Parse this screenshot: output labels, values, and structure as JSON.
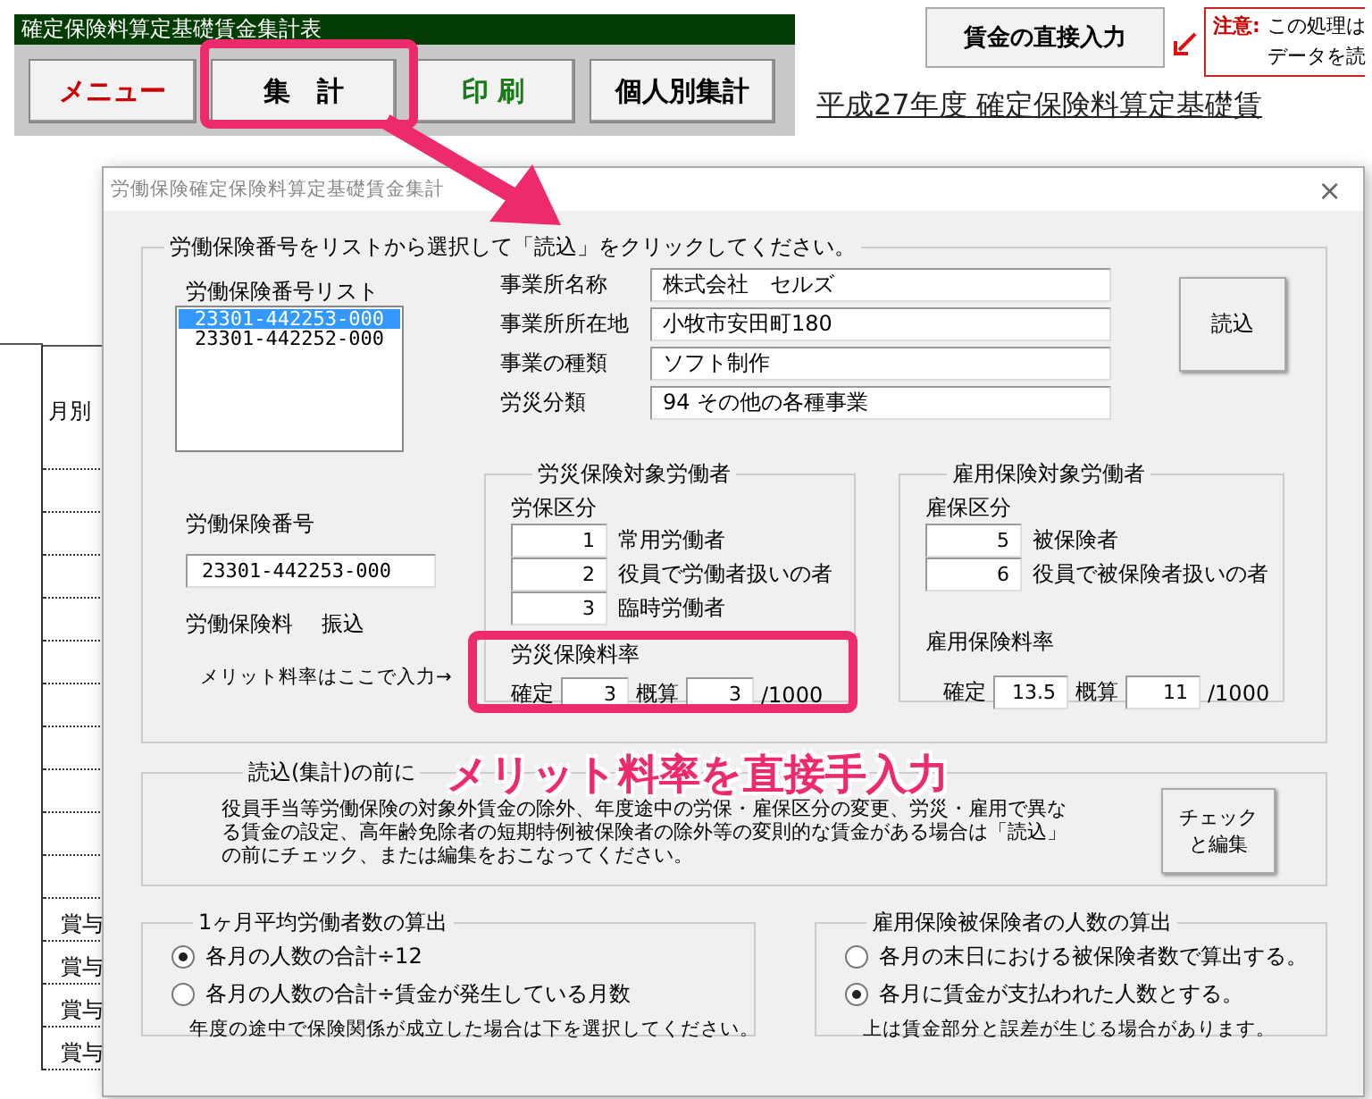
{
  "sheet": {
    "title_bar": "確定保険料算定基礎賃金集計表",
    "buttons": [
      {
        "label": "メニュー",
        "color": "#cc0000"
      },
      {
        "label": "集　計",
        "color": "#000000"
      },
      {
        "label": "印 刷",
        "color": "#1a7a1a"
      },
      {
        "label": "個人別集計",
        "color": "#000000"
      }
    ],
    "direct_input_button": "賃金の直接入力",
    "notice": {
      "label": "注意:",
      "lines": [
        "この処理は",
        "データを読"
      ]
    },
    "heading": "平成27年度 確定保険料算定基礎賃",
    "row_header": "月別",
    "row_labels": [
      "賞与",
      "賞与",
      "賞与",
      "賞与"
    ]
  },
  "dialog": {
    "title": "労働保険確定保険料算定基礎賃金集計",
    "close": "×",
    "main_group": {
      "legend": "労働保険番号をリストから選択して「読込」をクリックしてください。",
      "list_label": "労働保険番号リスト",
      "list_items": [
        {
          "text": "23301-442253-000",
          "selected": true
        },
        {
          "text": "23301-442252-000",
          "selected": false
        }
      ],
      "number_label": "労働保険番号",
      "number_value": "23301-442253-000",
      "premium_label": "労働保険料",
      "premium_value": "振込",
      "merit_hint": "メリット料率はここで入力→",
      "info_rows": [
        {
          "label": "事業所名称",
          "value": "株式会社　セルズ"
        },
        {
          "label": "事業所所在地",
          "value": "小牧市安田町180"
        },
        {
          "label": "事業の種類",
          "value": "ソフト制作"
        },
        {
          "label": "労災分類",
          "value": "94 その他の各種事業"
        }
      ],
      "load_button": "読込",
      "subgroups": [
        {
          "legend": "労災保険対象労働者",
          "class_label": "労保区分",
          "rows": [
            {
              "value": "1",
              "label": "常用労働者"
            },
            {
              "value": "2",
              "label": "役員で労働者扱いの者"
            },
            {
              "value": "3",
              "label": "臨時労働者"
            }
          ],
          "rate_label": "労災保険料率",
          "rate_fields": [
            {
              "label": "確定",
              "value": "3"
            },
            {
              "label": "概算",
              "value": "3"
            }
          ],
          "unit": "/1000"
        },
        {
          "legend": "雇用保険対象労働者",
          "class_label": "雇保区分",
          "rows": [
            {
              "value": "5",
              "label": "被保険者"
            },
            {
              "value": "6",
              "label": "役員で被保険者扱いの者"
            }
          ],
          "rate_label": "雇用保険料率",
          "rate_fields": [
            {
              "label": "確定",
              "value": "13.5"
            },
            {
              "label": "概算",
              "value": "11"
            }
          ],
          "unit": "/1000"
        }
      ]
    },
    "before_group": {
      "legend": "読込(集計)の前に",
      "text": "役員手当等労働保険の対象外賃金の除外、年度途中の労保・雇保区分の変更、労災・雇用で異なる賃金の設定、高年齢免除者の短期特例被保険者の除外等の変則的な賃金がある場合は「読込」の前にチェック、または編集をおこなってください。",
      "button_lines": [
        "チェック",
        "と編集"
      ]
    },
    "option_groups": [
      {
        "legend": "1ヶ月平均労働者数の算出",
        "options": [
          {
            "label": "各月の人数の合計÷12",
            "selected": true
          },
          {
            "label": "各月の人数の合計÷賃金が発生している月数",
            "selected": false
          }
        ],
        "note": "年度の途中で保険関係が成立した場合は下を選択してください。"
      },
      {
        "legend": "雇用保険被保険者の人数の算出",
        "options": [
          {
            "label": "各月の末日における被保険者数で算出する。",
            "selected": false
          },
          {
            "label": "各月に賃金が支払われた人数とする。",
            "selected": true
          }
        ],
        "note": "上は賃金部分と誤差が生じる場合があります。"
      }
    ]
  },
  "annotation": {
    "callout": "メリット料率を直接手入力"
  }
}
